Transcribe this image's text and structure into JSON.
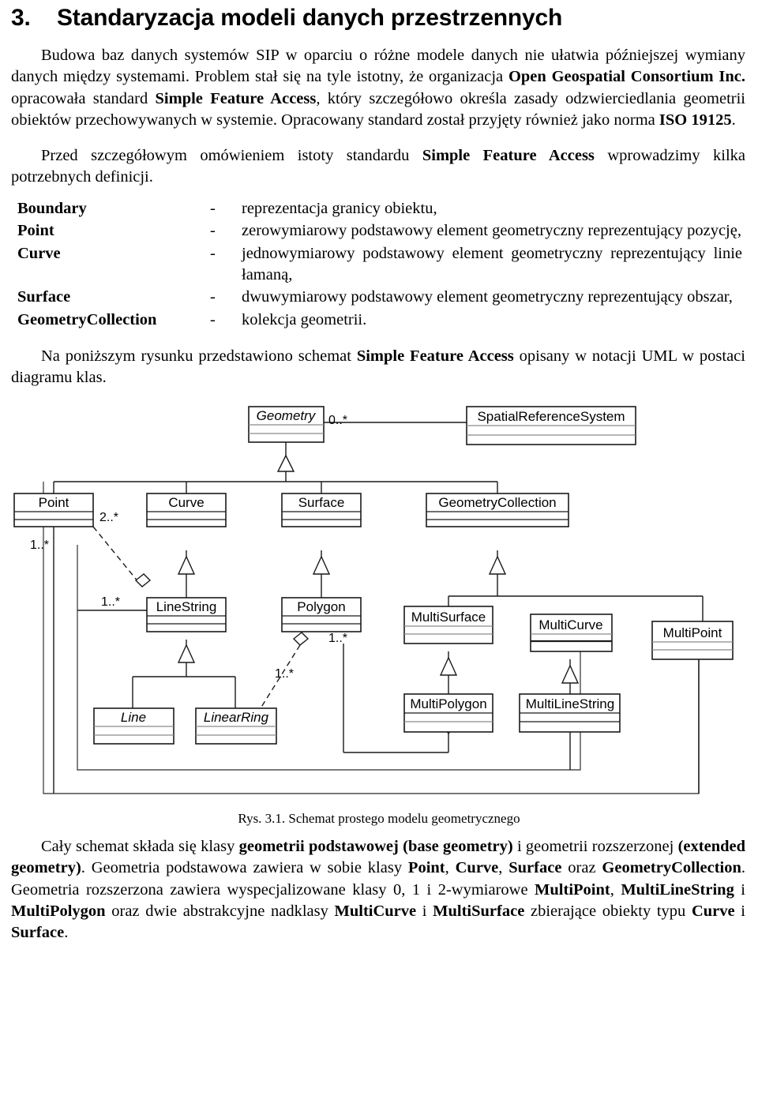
{
  "heading": {
    "number": "3.",
    "title": "Standaryzacja modeli danych przestrzennych"
  },
  "paragraphs": {
    "p1_a": "Budowa baz danych systemów SIP w oparciu o różne modele danych nie ułatwia późniejszej wymiany danych między systemami. Problem stał się na tyle istotny, że organizacja ",
    "p1_b_ogc": "Open Geospatial Consortium Inc.",
    "p1_c": " opracowała standard ",
    "p1_d_sfa": "Simple Feature Access",
    "p1_e": ", który szczegółowo określa zasady odzwierciedlania geometrii obiektów przechowywanych w systemie. Opracowany standard został przyjęty również jako norma ",
    "p1_f_iso": "ISO 19125",
    "p1_g": ".",
    "p2_a": "Przed szczegółowym omówieniem istoty standardu ",
    "p2_b_sfa": "Simple Feature Access",
    "p2_c": " wprowadzimy kilka potrzebnych definicji.",
    "p3_a": "Na poniższym rysunku przedstawiono schemat ",
    "p3_b_sfa": "Simple Feature Access",
    "p3_c": " opisany w notacji UML w postaci diagramu klas.",
    "p4_a": "Cały schemat składa się klasy ",
    "p4_b": "geometrii podstawowej (base geometry)",
    "p4_c": " i geometrii rozszerzonej ",
    "p4_d": "(extended geometry)",
    "p4_e": ". Geometria podstawowa zawiera w sobie klasy ",
    "p4_f": "Point",
    "p4_g": ", ",
    "p4_h": "Curve",
    "p4_i": ", ",
    "p4_j": "Surface",
    "p4_k": " oraz ",
    "p4_l": "GeometryCollection",
    "p4_m": ". Geometria rozszerzona zawiera wyspecjalizowane klasy 0, 1 i 2-wymiarowe ",
    "p4_n": "MultiPoint",
    "p4_o": ", ",
    "p4_p": "MultiLineString",
    "p4_q": " i ",
    "p4_r": "MultiPolygon",
    "p4_s": " oraz dwie abstrakcyjne nadklasy ",
    "p4_t": "MultiCurve",
    "p4_u": " i ",
    "p4_v": "MultiSurface",
    "p4_w": " zbierające obiekty typu ",
    "p4_x": "Curve",
    "p4_y": " i ",
    "p4_z": "Surface",
    "p4_end": "."
  },
  "definitions": {
    "dash": "-",
    "items": [
      {
        "term": "Boundary",
        "desc": "reprezentacja granicy obiektu,"
      },
      {
        "term": "Point",
        "desc": "zerowymiarowy podstawowy element geometryczny reprezentujący pozycję,"
      },
      {
        "term": "Curve",
        "desc": "jednowymiarowy podstawowy element geometryczny reprezentujący linie łamaną,"
      },
      {
        "term": "Surface",
        "desc": "dwuwymiarowy podstawowy element geometryczny reprezentujący obszar,"
      },
      {
        "term": "GeometryCollection",
        "desc": "kolekcja geometrii."
      }
    ]
  },
  "figure": {
    "caption": "Rys. 3.1. Schemat prostego modelu geometrycznego",
    "classes": {
      "geometry": "Geometry",
      "spatial_reference_system": "SpatialReferenceSystem",
      "point": "Point",
      "curve": "Curve",
      "surface": "Surface",
      "geometry_collection": "GeometryCollection",
      "line_string": "LineString",
      "polygon": "Polygon",
      "multi_surface": "MultiSurface",
      "multi_curve": "MultiCurve",
      "multi_point": "MultiPoint",
      "line": "Line",
      "linear_ring": "LinearRing",
      "multi_polygon": "MultiPolygon",
      "multi_line_string": "MultiLineString"
    },
    "multiplicities": {
      "geometry_srs": "0..*",
      "point_linestring": "2..*",
      "point_multipoint": "1..*",
      "linestring_multilinestring": "1..*",
      "polygon_linearring": "1..*",
      "polygon_multipolygon": "1..*"
    }
  },
  "colors": {
    "ink": "#000000",
    "line": "#1a1a1a",
    "paper": "#ffffff"
  }
}
